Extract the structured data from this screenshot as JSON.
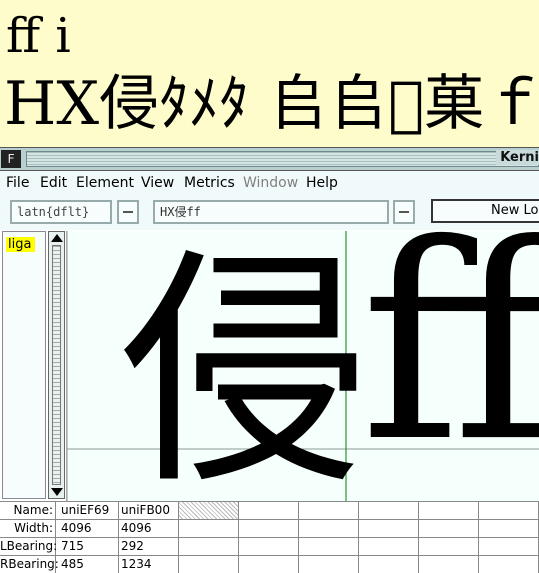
{
  "preview": {
    "line1": "ﬀ i",
    "line2": "HX侵ﾀﾒﾀ 𠂤𠂤𡛢菓ｆａ"
  },
  "window": {
    "title": "Kerni",
    "app_icon": "F"
  },
  "menubar": {
    "items": [
      {
        "label": "File",
        "enabled": true
      },
      {
        "label": "Edit",
        "enabled": true
      },
      {
        "label": "Element",
        "enabled": true
      },
      {
        "label": "View",
        "enabled": true
      },
      {
        "label": "Metrics",
        "enabled": true
      },
      {
        "label": "Window",
        "enabled": false
      },
      {
        "label": "Help",
        "enabled": true
      }
    ]
  },
  "toolbar": {
    "script_lang": "latn{dflt}",
    "text_field": "HX侵ff",
    "new_lookup_label": "New Lo"
  },
  "feature_list": {
    "items": [
      "liga"
    ]
  },
  "canvas": {
    "glyphs": [
      "侵",
      "ﬀ"
    ]
  },
  "metrics": {
    "labels": {
      "name": "Name:",
      "width": "Width:",
      "lbearing": "LBearing:",
      "rbearing": "RBearing:"
    },
    "columns": [
      {
        "name": "uniEF69",
        "width": "4096",
        "lbearing": "715",
        "rbearing": "485"
      },
      {
        "name": "uniFB00",
        "width": "4096",
        "lbearing": "292",
        "rbearing": "1234"
      }
    ]
  },
  "colors": {
    "preview_bg": "#fffccc",
    "canvas_bg": "#f5fffb",
    "selection": "#ffff00",
    "guide_green": "#008000"
  },
  "icons": {
    "scroll_up": "triangle-up",
    "scroll_down": "triangle-down",
    "dropdown": "dropdown-bar"
  }
}
